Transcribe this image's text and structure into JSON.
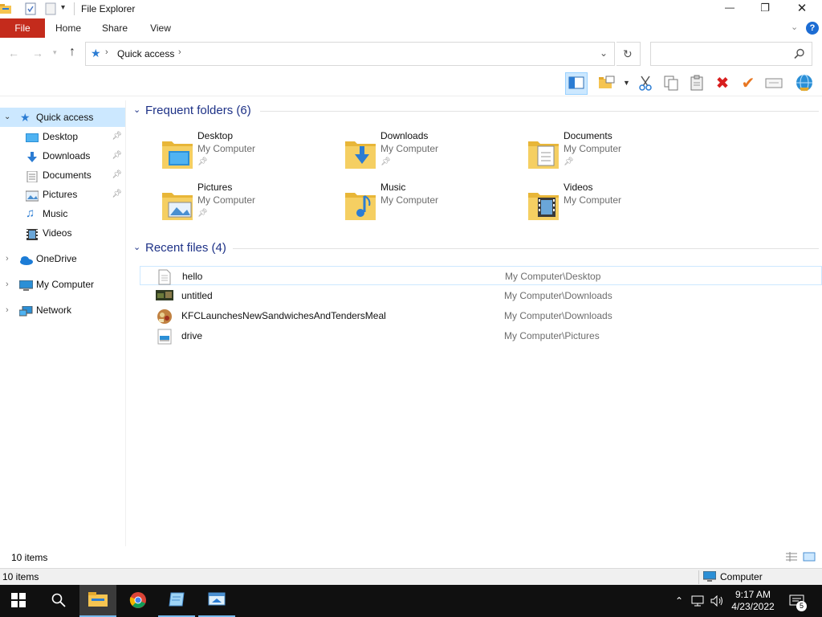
{
  "window": {
    "title": "File Explorer",
    "controls": {
      "minimize": "—",
      "restore": "❐",
      "close": "✕"
    }
  },
  "ribbon": {
    "tabs": [
      "File",
      "Home",
      "Share",
      "View"
    ],
    "help": "?"
  },
  "address": {
    "crumbs": [
      "Quick access"
    ],
    "search_placeholder": ""
  },
  "nav": {
    "quick_access": "Quick access",
    "pinned": [
      {
        "label": "Desktop",
        "icon": "desktop-icon",
        "pinned": true
      },
      {
        "label": "Downloads",
        "icon": "downloads-icon",
        "pinned": true
      },
      {
        "label": "Documents",
        "icon": "documents-icon",
        "pinned": true
      },
      {
        "label": "Pictures",
        "icon": "pictures-icon",
        "pinned": true
      },
      {
        "label": "Music",
        "icon": "music-icon",
        "pinned": false
      },
      {
        "label": "Videos",
        "icon": "videos-icon",
        "pinned": false
      }
    ],
    "roots": [
      {
        "label": "OneDrive",
        "icon": "onedrive-icon"
      },
      {
        "label": "My Computer",
        "icon": "computer-icon"
      },
      {
        "label": "Network",
        "icon": "network-icon"
      }
    ]
  },
  "frequent": {
    "header": "Frequent folders (6)",
    "folders": [
      {
        "name": "Desktop",
        "location": "My Computer",
        "pinned": true
      },
      {
        "name": "Downloads",
        "location": "My Computer",
        "pinned": true
      },
      {
        "name": "Documents",
        "location": "My Computer",
        "pinned": true
      },
      {
        "name": "Pictures",
        "location": "My Computer",
        "pinned": true
      },
      {
        "name": "Music",
        "location": "My Computer",
        "pinned": false
      },
      {
        "name": "Videos",
        "location": "My Computer",
        "pinned": false
      }
    ]
  },
  "recent": {
    "header": "Recent files (4)",
    "files": [
      {
        "name": "hello",
        "path": "My Computer\\Desktop",
        "icon": "text-file-icon"
      },
      {
        "name": "untitled",
        "path": "My Computer\\Downloads",
        "icon": "image-file-icon"
      },
      {
        "name": "KFCLaunchesNewSandwichesAndTendersMeal",
        "path": "My Computer\\Downloads",
        "icon": "image-file-icon"
      },
      {
        "name": "drive",
        "path": "My Computer\\Pictures",
        "icon": "image-file-icon"
      }
    ]
  },
  "status": {
    "items_count": "10 items",
    "items_count_bottom": "10 items",
    "location": "Computer"
  },
  "taskbar": {
    "time": "9:17 AM",
    "date": "4/23/2022",
    "notifications": "5"
  },
  "colors": {
    "file_tab": "#c42b1c",
    "accent": "#1e3287",
    "selection": "#cce8ff"
  }
}
